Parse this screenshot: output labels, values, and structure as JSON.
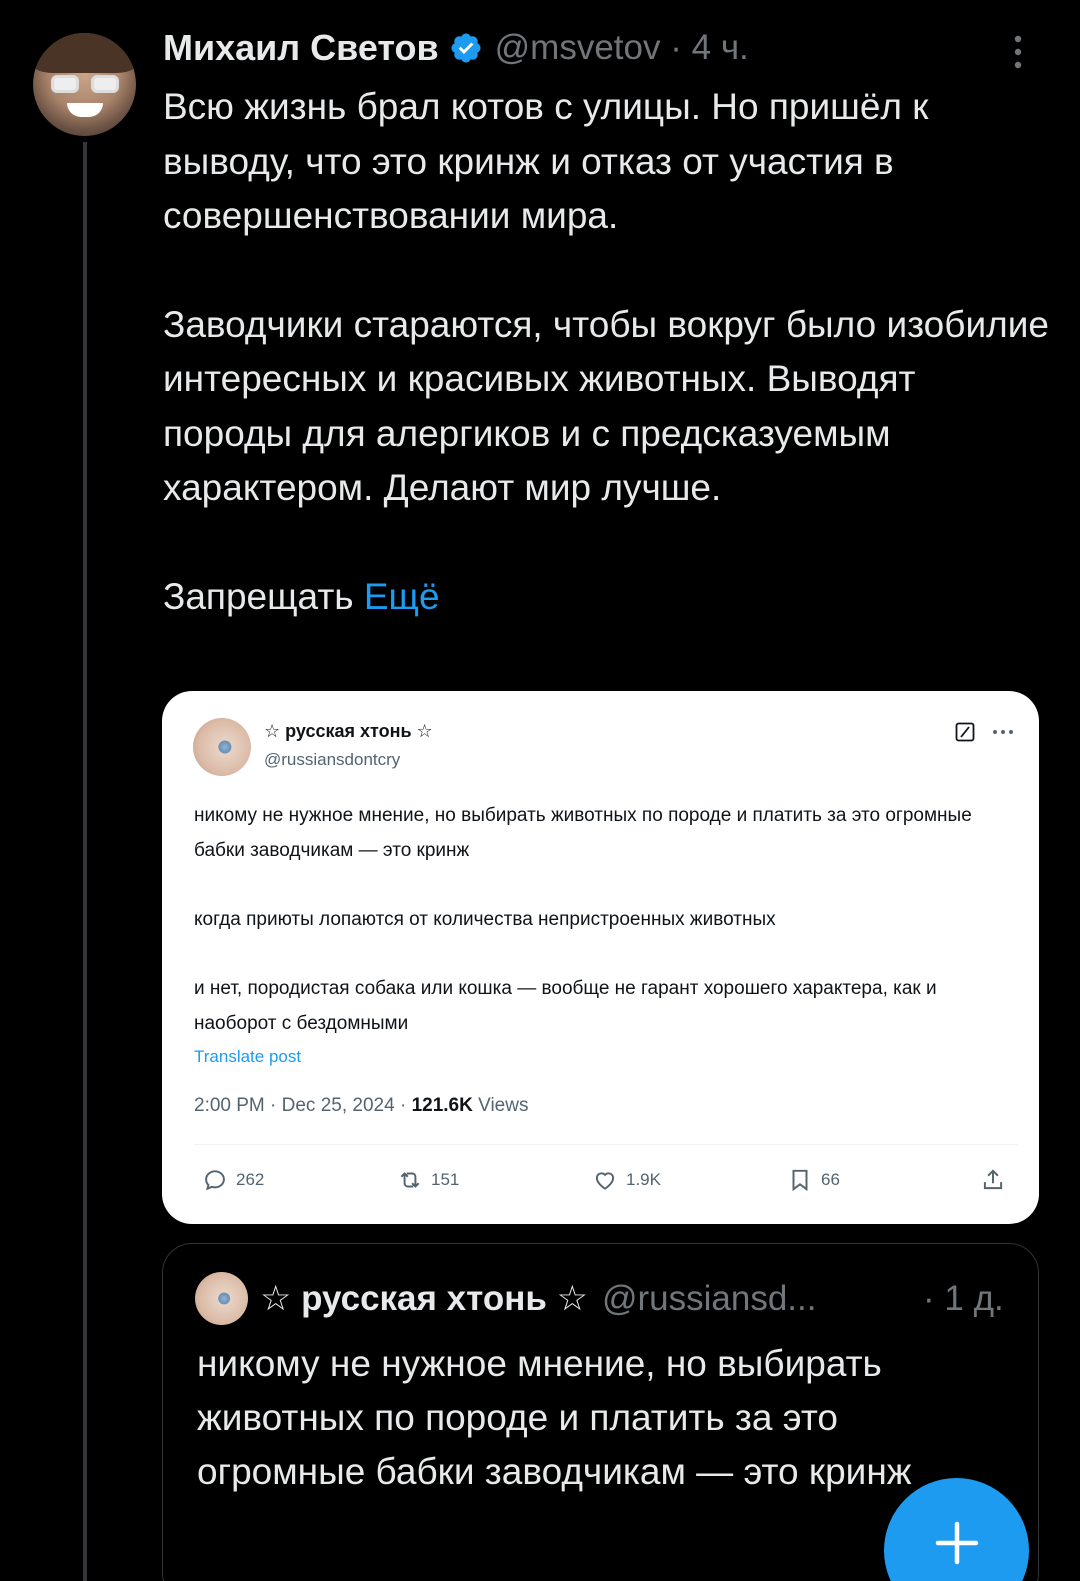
{
  "tweet": {
    "author_name": "Михаил Светов",
    "handle": "@msvetov",
    "separator": "·",
    "time": "4 ч.",
    "paragraphs": [
      "Всю жизнь брал котов с улицы. Но пришёл к выводу, что это кринж и отказ от участия в совершенствовании мира.",
      "Заводчики стараются, чтобы вокруг было изобилие интересных и красивых животных. Выводят породы для алергиков и с предсказуемым характером. Делают мир лучше."
    ],
    "truncated_text": "Запрещать",
    "more_label": "Ещё"
  },
  "screenshot": {
    "name": "☆ русская хтонь ☆",
    "handle": "@russiansdontcry",
    "paragraphs": [
      "никому не нужное мнение, но выбирать животных по породе и платить за это огромные бабки заводчикам — это кринж",
      "когда приюты лопаются от количества непристроенных животных",
      "и нет, породистая собака или кошка — вообще не гарант хорошего характера, как и наоборот с бездомными"
    ],
    "translate_label": "Translate post",
    "meta_datetime": "2:00 PM · Dec 25, 2024 · ",
    "views_count": "121.6K",
    "views_label": " Views",
    "replies": "262",
    "reposts": "151",
    "likes": "1.9K",
    "bookmarks": "66"
  },
  "quote": {
    "name": "☆ русская хтонь ☆",
    "handle": "@russiansd...",
    "time": "· 1 д.",
    "text": "никому не нужное мнение, но выбирать животных по породе и платить за это огромные бабки заводчикам — это кринж"
  },
  "icons": {
    "verified": "verified-badge-icon",
    "more": "more-vertical-icon",
    "fab": "plus-icon"
  },
  "colors": {
    "accent": "#1d9bf0",
    "background": "#000000",
    "secondary_text": "#71767b"
  }
}
